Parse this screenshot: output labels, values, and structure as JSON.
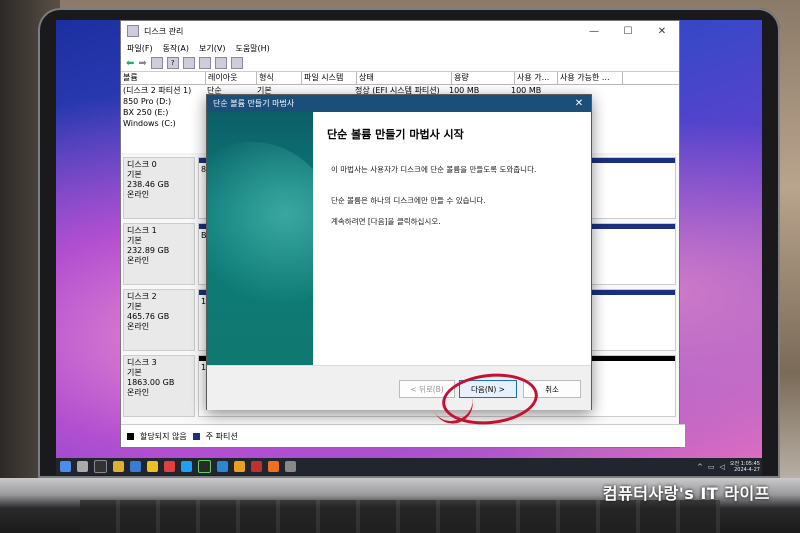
{
  "window": {
    "title": "디스크 관리",
    "minimize": "—",
    "maximize": "☐",
    "close": "✕"
  },
  "menu": [
    "파일(F)",
    "동작(A)",
    "보기(V)",
    "도움말(H)"
  ],
  "volume_table": {
    "headers": [
      "볼륨",
      "레이아웃",
      "형식",
      "파일 시스템",
      "상태",
      "용량",
      "사용 가...",
      "사용 가능한 ..."
    ],
    "rows": [
      {
        "name": "(디스크 2 파티션 1)",
        "layout": "단순",
        "type": "기본",
        "fs": "",
        "status": "정상 (EFI 시스템 파티션)",
        "capacity": "100 MB",
        "free": "100 MB"
      },
      {
        "name": "850 Pro (D:)"
      },
      {
        "name": "BX 250 (E:)"
      },
      {
        "name": "Windows (C:)"
      }
    ]
  },
  "disks": [
    {
      "name": "디스크 0",
      "type": "기본",
      "size": "238.46 GB",
      "status": "온라인",
      "part": "89"
    },
    {
      "name": "디스크 1",
      "type": "기본",
      "size": "232.89 GB",
      "status": "온라인",
      "part": "B"
    },
    {
      "name": "디스크 2",
      "type": "기본",
      "size": "465.76 GB",
      "status": "온라인",
      "part": "1("
    },
    {
      "name": "디스크 3",
      "type": "기본",
      "size": "1863.00 GB",
      "status": "온라인",
      "part": "18"
    }
  ],
  "legend": {
    "unallocated": "할당되지 않음",
    "primary": "주 파티션"
  },
  "wizard": {
    "title": "단순 볼륨 만들기 마법사",
    "heading": "단순 볼륨 만들기 마법사 시작",
    "p1": "이 마법사는 사용자가 디스크에 단순 볼륨을 만들도록 도와줍니다.",
    "p2": "단순 볼륨은 하나의 디스크에만 만들 수 있습니다.",
    "p3": "계속하려면 [다음]을 클릭하십시오.",
    "back": "< 뒤로(B)",
    "next": "다음(N) >",
    "cancel": "취소"
  },
  "taskbar": {
    "time": "오전 1:05:45",
    "date": "2024-4-27"
  },
  "watermark": "컴퓨터사랑's IT 라이프",
  "colors": {
    "accent": "#1a2f7e",
    "highlight_circle": "#c8102e",
    "wizard_side": "#0b7c78"
  }
}
